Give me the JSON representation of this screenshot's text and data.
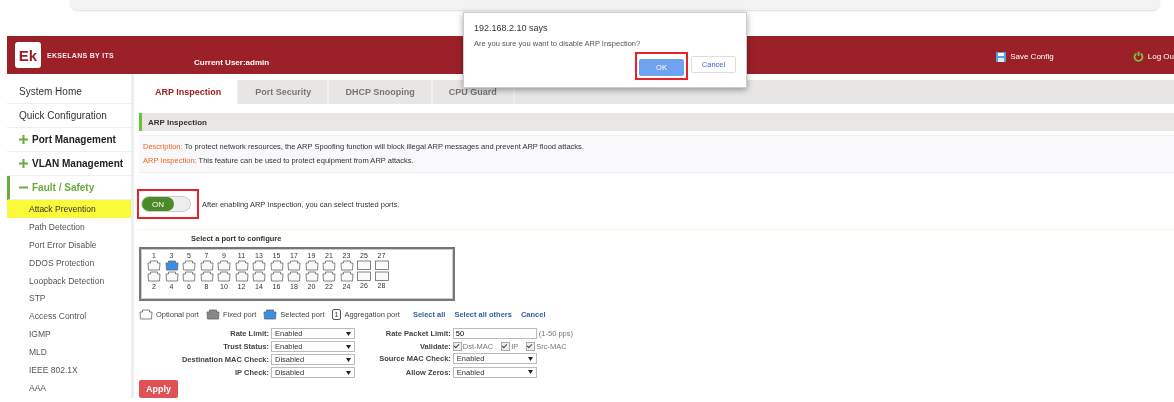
{
  "header": {
    "logo_mark": "Ek",
    "brand": "EKSELANS BY ITS",
    "current_user": "Current User:admin",
    "save_config": "Save Config",
    "log_out": "Log Ou"
  },
  "dialog": {
    "title": "192.168.2.10 says",
    "message": "Are you sure you want to disable ARP Inspection?",
    "ok": {
      "label": "OK",
      "highlighted": true
    },
    "cancel": "Cancel"
  },
  "sidebar": {
    "items": [
      {
        "label": "System Home",
        "kind": "page"
      },
      {
        "label": "Quick Configuration",
        "kind": "page"
      },
      {
        "label": "Port Management",
        "kind": "group",
        "expanded": false
      },
      {
        "label": "VLAN Management",
        "kind": "group",
        "expanded": false
      },
      {
        "label": "Fault / Safety",
        "kind": "group",
        "expanded": true,
        "children": [
          {
            "label": "Attack Prevention",
            "selected": true
          },
          {
            "label": "Path Detection",
            "selected": false
          },
          {
            "label": "Port Error Disable",
            "selected": false
          },
          {
            "label": "DDOS Protection",
            "selected": false
          },
          {
            "label": "Loopback Detection",
            "selected": false
          },
          {
            "label": "STP",
            "selected": false
          },
          {
            "label": "Access Control",
            "selected": false
          },
          {
            "label": "IGMP",
            "selected": false
          },
          {
            "label": "MLD",
            "selected": false
          },
          {
            "label": "IEEE 802.1X",
            "selected": false
          },
          {
            "label": "AAA",
            "selected": false
          }
        ]
      }
    ]
  },
  "tabs": [
    {
      "label": "ARP Inspection",
      "selected": true
    },
    {
      "label": "Port Security",
      "selected": false
    },
    {
      "label": "DHCP Snooping",
      "selected": false
    },
    {
      "label": "CPU Guard",
      "selected": false
    }
  ],
  "section_title": "ARP Inspection",
  "description": [
    {
      "label": "Description:",
      "text": "To protect network resources, the ARP Spoofing function will block illegal ARP messages and prevent ARP flood attacks."
    },
    {
      "label": "ARP Inspection:",
      "text": "This feature can be used to protect equipment from ARP attacks."
    }
  ],
  "toggle": {
    "label": "ON",
    "on": true,
    "highlighted": true,
    "hint": "After enabling ARP Inspection, you can select trusted ports."
  },
  "port_panel": {
    "title": "Select a port to configure",
    "top_row": [
      {
        "label": "1",
        "kind": "copper",
        "selected": false
      },
      {
        "label": "3",
        "kind": "copper",
        "selected": true
      },
      {
        "label": "5",
        "kind": "copper",
        "selected": false
      },
      {
        "label": "7",
        "kind": "copper",
        "selected": false
      },
      {
        "label": "9",
        "kind": "copper",
        "selected": false
      },
      {
        "label": "11",
        "kind": "copper",
        "selected": false
      },
      {
        "label": "13",
        "kind": "copper",
        "selected": false
      },
      {
        "label": "15",
        "kind": "copper",
        "selected": false
      },
      {
        "label": "17",
        "kind": "copper",
        "selected": false
      },
      {
        "label": "19",
        "kind": "copper",
        "selected": false
      },
      {
        "label": "21",
        "kind": "copper",
        "selected": false
      },
      {
        "label": "23",
        "kind": "copper",
        "selected": false
      },
      {
        "label": "25",
        "kind": "fiber",
        "selected": false
      },
      {
        "label": "27",
        "kind": "fiber",
        "selected": false
      }
    ],
    "bottom_row": [
      {
        "label": "2",
        "kind": "copper",
        "selected": false
      },
      {
        "label": "4",
        "kind": "copper",
        "selected": false
      },
      {
        "label": "6",
        "kind": "copper",
        "selected": false
      },
      {
        "label": "8",
        "kind": "copper",
        "selected": false
      },
      {
        "label": "10",
        "kind": "copper",
        "selected": false
      },
      {
        "label": "12",
        "kind": "copper",
        "selected": false
      },
      {
        "label": "14",
        "kind": "copper",
        "selected": false
      },
      {
        "label": "16",
        "kind": "copper",
        "selected": false
      },
      {
        "label": "18",
        "kind": "copper",
        "selected": false
      },
      {
        "label": "20",
        "kind": "copper",
        "selected": false
      },
      {
        "label": "22",
        "kind": "copper",
        "selected": false
      },
      {
        "label": "24",
        "kind": "copper",
        "selected": false
      },
      {
        "label": "26",
        "kind": "fiber",
        "selected": false
      },
      {
        "label": "28",
        "kind": "fiber",
        "selected": false
      }
    ]
  },
  "legend": [
    {
      "kind": "optional",
      "label": "Optional port"
    },
    {
      "kind": "fixed",
      "label": "Fixed port"
    },
    {
      "kind": "selected",
      "label": "Selected port"
    },
    {
      "kind": "aggregation",
      "label": "Aggregation port",
      "icon_text": "1"
    }
  ],
  "links": [
    "Select all",
    "Select all others",
    "Cancel"
  ],
  "form_left": [
    {
      "label": "Rate Limit:",
      "value": "Enabled"
    },
    {
      "label": "Trust Status:",
      "value": "Enabled"
    },
    {
      "label": "Destination MAC Check:",
      "value": "Disabled"
    },
    {
      "label": "IP Check:",
      "value": "Disabled"
    }
  ],
  "form_right": [
    {
      "kind": "input",
      "label": "Rate Packet Limit:",
      "value": "50",
      "hint": "(1-50 pps)"
    },
    {
      "kind": "checks",
      "label": "Validate:",
      "options": [
        {
          "label": "Dst-MAC",
          "checked": true
        },
        {
          "label": "IP",
          "checked": true
        },
        {
          "label": "Src-MAC",
          "checked": true
        }
      ]
    },
    {
      "kind": "select",
      "label": "Source MAC Check:",
      "value": "Enabled"
    },
    {
      "kind": "select",
      "label": "Allow Zeros:",
      "value": "Enabled"
    }
  ],
  "apply": "Apply"
}
